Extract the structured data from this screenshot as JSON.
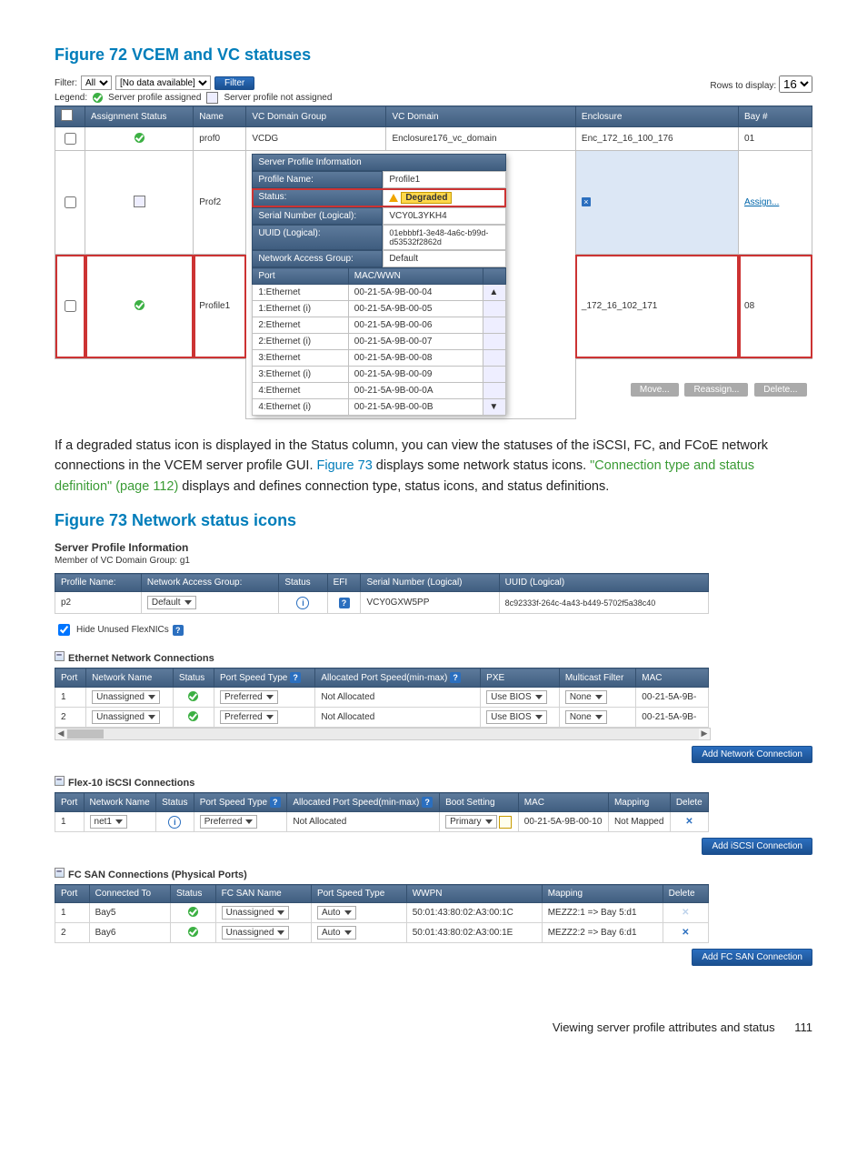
{
  "fig72": {
    "title": "Figure 72 VCEM and VC statuses",
    "filter_label": "Filter:",
    "filter_all": "All",
    "filter_nodata": "[No data available]",
    "filter_btn": "Filter",
    "legend": "Legend:",
    "legend_assigned": "Server profile assigned",
    "legend_not": "Server profile not assigned",
    "rows_display": "Rows to display:",
    "rows_value": "16",
    "cols": {
      "assignment": "Assignment Status",
      "name": "Name",
      "vcdg": "VC Domain Group",
      "vcd": "VC Domain",
      "enclosure": "Enclosure",
      "bay": "Bay #"
    },
    "rows": [
      {
        "name": "prof0",
        "vcdg": "VCDG",
        "vcd": "Enclosure176_vc_domain",
        "enc": "Enc_172_16_100_176",
        "bay": "01",
        "status": "ok"
      },
      {
        "name": "Prof2",
        "vcdg": "",
        "vcd": "",
        "enc": "",
        "bay": "Assign...",
        "status": "chk"
      },
      {
        "name": "Profile1",
        "vcdg": "",
        "vcd": "",
        "enc": "_172_16_102_171",
        "bay": "08",
        "status": "ok"
      }
    ],
    "popup": {
      "header": "Server Profile Information",
      "k_profile": "Profile Name:",
      "v_profile": "Profile1",
      "k_status": "Status:",
      "v_status": "Degraded",
      "k_sn": "Serial Number (Logical):",
      "v_sn": "VCY0L3YKH4",
      "k_uuid": "UUID (Logical):",
      "v_uuid": "01ebbbf1-3e48-4a6c-b99d-d53532f2862d",
      "k_nag": "Network Access Group:",
      "v_nag": "Default",
      "col_port": "Port",
      "col_mac": "MAC/WWN",
      "ports": [
        {
          "p": "1:Ethernet",
          "m": "00-21-5A-9B-00-04"
        },
        {
          "p": "1:Ethernet (i)",
          "m": "00-21-5A-9B-00-05"
        },
        {
          "p": "2:Ethernet",
          "m": "00-21-5A-9B-00-06"
        },
        {
          "p": "2:Ethernet (i)",
          "m": "00-21-5A-9B-00-07"
        },
        {
          "p": "3:Ethernet",
          "m": "00-21-5A-9B-00-08"
        },
        {
          "p": "3:Ethernet (i)",
          "m": "00-21-5A-9B-00-09"
        },
        {
          "p": "4:Ethernet",
          "m": "00-21-5A-9B-00-0A"
        },
        {
          "p": "4:Ethernet (i)",
          "m": "00-21-5A-9B-00-0B"
        }
      ],
      "btn_move": "Move...",
      "btn_reassign": "Reassign...",
      "btn_delete": "Delete..."
    }
  },
  "body": {
    "p1a": "If a degraded status icon is displayed in the Status column, you can view the statuses of the iSCSI, FC, and FCoE network connections in the VCEM server profile GUI. ",
    "p1b": "Figure 73",
    "p1c": " displays some network status icons. ",
    "p1d": "\"Connection type and status definition\" (page 112)",
    "p1e": " displays and defines connection type, status icons, and status definitions."
  },
  "fig73": {
    "title": "Figure 73 Network status icons",
    "spi_title": "Server Profile Information",
    "member": "Member of VC Domain Group: g1",
    "hdr": {
      "profile_name": "Profile Name:",
      "profile_val": "p2",
      "nag": "Network Access Group:",
      "nag_val": "Default",
      "status": "Status",
      "efi": "EFI",
      "sn": "Serial Number (Logical)",
      "sn_val": "VCY0GXW5PP",
      "uuid": "UUID (Logical)",
      "uuid_val": "8c92333f-264c-4a43-b449-5702f5a38c40"
    },
    "hide": "Hide Unused FlexNICs",
    "eth": {
      "title": "Ethernet Network Connections",
      "cols": {
        "port": "Port",
        "net": "Network Name",
        "status": "Status",
        "pst": "Port Speed Type",
        "alloc": "Allocated Port Speed(min-max)",
        "pxe": "PXE",
        "mcf": "Multicast Filter",
        "mac": "MAC"
      },
      "rows": [
        {
          "port": "1",
          "net": "Unassigned",
          "pst": "Preferred",
          "alloc": "Not Allocated",
          "pxe": "Use BIOS",
          "mcf": "None",
          "mac": "00-21-5A-9B-"
        },
        {
          "port": "2",
          "net": "Unassigned",
          "pst": "Preferred",
          "alloc": "Not Allocated",
          "pxe": "Use BIOS",
          "mcf": "None",
          "mac": "00-21-5A-9B-"
        }
      ],
      "add": "Add Network Connection"
    },
    "iscsi": {
      "title": "Flex-10 iSCSI Connections",
      "cols": {
        "port": "Port",
        "net": "Network Name",
        "status": "Status",
        "pst": "Port Speed Type",
        "alloc": "Allocated Port Speed(min-max)",
        "boot": "Boot Setting",
        "mac": "MAC",
        "map": "Mapping",
        "del": "Delete"
      },
      "rows": [
        {
          "port": "1",
          "net": "net1",
          "pst": "Preferred",
          "alloc": "Not Allocated",
          "boot": "Primary",
          "mac": "00-21-5A-9B-00-10",
          "map": "Not Mapped"
        }
      ],
      "add": "Add iSCSI Connection"
    },
    "fc": {
      "title": "FC SAN Connections (Physical Ports)",
      "cols": {
        "port": "Port",
        "conn": "Connected To",
        "status": "Status",
        "san": "FC SAN Name",
        "pst": "Port Speed Type",
        "wwpn": "WWPN",
        "map": "Mapping",
        "del": "Delete"
      },
      "rows": [
        {
          "port": "1",
          "conn": "Bay5",
          "san": "Unassigned",
          "pst": "Auto",
          "wwpn": "50:01:43:80:02:A3:00:1C",
          "map": "MEZZ2:1 => Bay 5:d1",
          "del_enabled": false
        },
        {
          "port": "2",
          "conn": "Bay6",
          "san": "Unassigned",
          "pst": "Auto",
          "wwpn": "50:01:43:80:02:A3:00:1E",
          "map": "MEZZ2:2 => Bay 6:d1",
          "del_enabled": true
        }
      ],
      "add": "Add FC SAN Connection"
    }
  },
  "footer": {
    "text": "Viewing server profile attributes and status",
    "page": "111"
  }
}
